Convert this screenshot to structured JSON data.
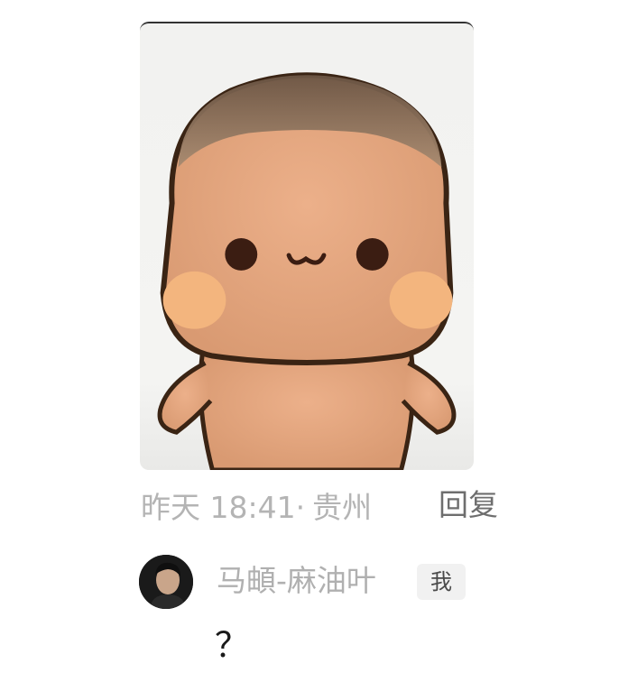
{
  "comment": {
    "image": {
      "icon": "cute-bean-character-sticker",
      "background_color": "#f3f3f1",
      "skin_color": "#e7a780",
      "blush_color": "#f3b57e",
      "hair_color": "#8a705a"
    },
    "meta": {
      "time": "昨天 18:41·",
      "location": "贵州"
    },
    "reply_label": "回复"
  },
  "reply": {
    "avatar": "user-avatar-photo",
    "username": "马頔-麻油叶",
    "badge": "我",
    "text": "？"
  },
  "colors": {
    "meta_text": "#b4b4b4",
    "reply_button": "#6e6e6e",
    "username": "#b0b0b0",
    "badge_bg": "#f1f1f1",
    "comment_text": "#1a1a1a"
  }
}
